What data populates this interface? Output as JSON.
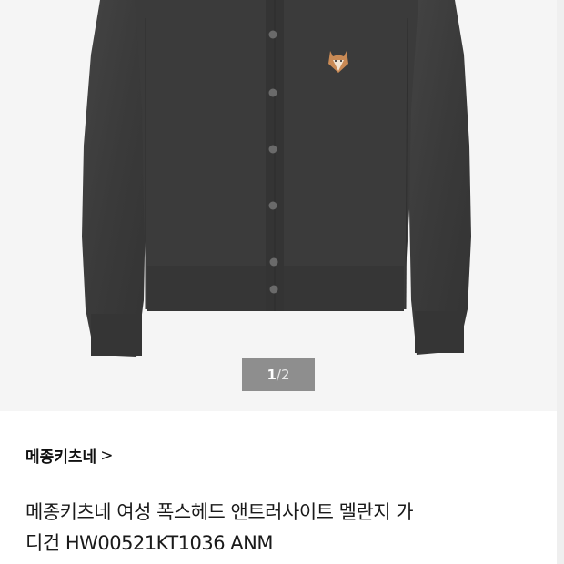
{
  "colors": {
    "hero_background": "#f5f5f5",
    "garment": "#3a3a3a",
    "pager_background": "#8e8e8e"
  },
  "image": {
    "description_icon": "cardigan-product-photo"
  },
  "pager": {
    "current": "1",
    "separator": "/",
    "total": "2"
  },
  "brand": {
    "name": "메종키츠네",
    "arrow": ">"
  },
  "product": {
    "title_line1": "메종키츠네 여성 폭스헤드 앤트러사이트 멜란지 가",
    "title_line2": "디건 HW00521KT1036 ANM"
  }
}
